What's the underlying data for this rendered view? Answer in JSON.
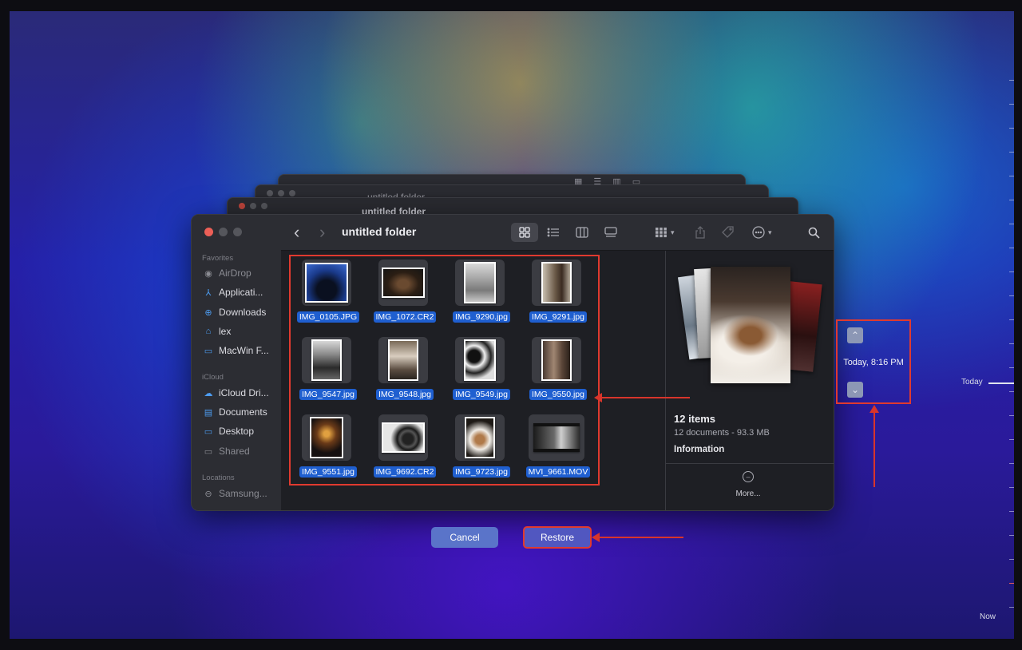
{
  "finder": {
    "title": "untitled folder",
    "back_glyph": "‹",
    "forward_glyph": "›",
    "sidebar": {
      "favorites_label": "Favorites",
      "favorites": [
        {
          "label": "AirDrop",
          "icon": "airdrop-icon"
        },
        {
          "label": "Applicati...",
          "icon": "applications-icon"
        },
        {
          "label": "Downloads",
          "icon": "downloads-icon"
        },
        {
          "label": "lex",
          "icon": "home-icon"
        },
        {
          "label": "MacWin F...",
          "icon": "folder-icon"
        }
      ],
      "icloud_label": "iCloud",
      "icloud": [
        {
          "label": "iCloud Dri...",
          "icon": "cloud-icon"
        },
        {
          "label": "Documents",
          "icon": "document-icon"
        },
        {
          "label": "Desktop",
          "icon": "desktop-icon"
        },
        {
          "label": "Shared",
          "icon": "shared-folder-icon"
        }
      ],
      "locations_label": "Locations",
      "locations": [
        {
          "label": "Samsung...",
          "icon": "drive-icon"
        }
      ]
    },
    "files": [
      {
        "name": "IMG_0105.JPG"
      },
      {
        "name": "IMG_1072.CR2"
      },
      {
        "name": "IMG_9290.jpg"
      },
      {
        "name": "IMG_9291.jpg"
      },
      {
        "name": "IMG_9547.jpg"
      },
      {
        "name": "IMG_9548.jpg"
      },
      {
        "name": "IMG_9549.jpg"
      },
      {
        "name": "IMG_9550.jpg"
      },
      {
        "name": "IMG_9551.jpg"
      },
      {
        "name": "IMG_9692.CR2"
      },
      {
        "name": "IMG_9723.jpg"
      },
      {
        "name": "MVI_9661.MOV"
      }
    ],
    "preview": {
      "count": "12 items",
      "details": "12 documents - 93.3 MB",
      "info_label": "Information",
      "more_label": "More..."
    }
  },
  "buttons": {
    "cancel": "Cancel",
    "restore": "Restore"
  },
  "time_machine": {
    "date": "Today, 8:16 PM",
    "timeline_top": "Today",
    "timeline_bottom": "Now"
  },
  "colors": {
    "highlight_red": "#e03a2f",
    "selection_blue": "#1f5fd0"
  }
}
